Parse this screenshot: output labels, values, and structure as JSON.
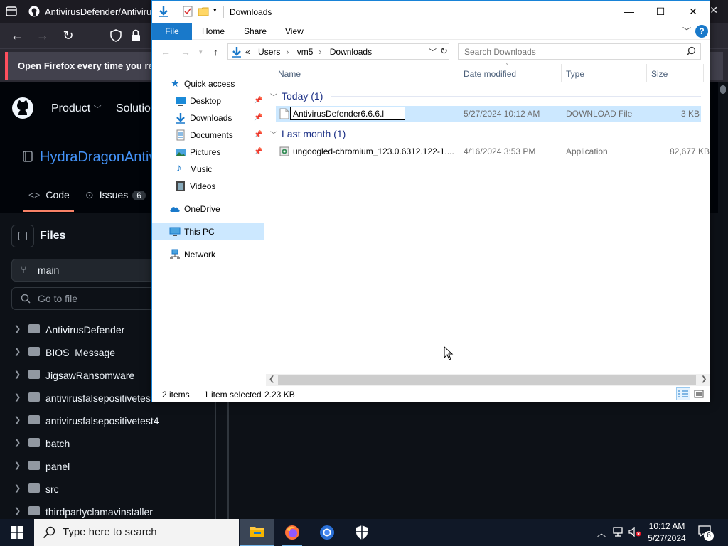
{
  "browser": {
    "tab_title": "AntivirusDefender/Antivirus",
    "notification": "Open Firefox every time you resta",
    "tab_close": "✕"
  },
  "github": {
    "menu": [
      "Product",
      "Solutio"
    ],
    "repo_name": "HydraDragonAntiv",
    "tabs": {
      "code": "Code",
      "issues": "Issues",
      "issues_count": "6"
    },
    "files_title": "Files",
    "branch": "main",
    "go_to_file": "Go to file",
    "tree": [
      "AntivirusDefender",
      "BIOS_Message",
      "JigsawRansomware",
      "antivirusfalsepositivetest",
      "antivirusfalsepositivetest4",
      "batch",
      "panel",
      "src",
      "thirdpartyclamavinstaller"
    ]
  },
  "explorer": {
    "title": "Downloads",
    "window_buttons": {
      "minimize": "—",
      "maximize": "☐",
      "close": "✕"
    },
    "ribbon": {
      "file": "File",
      "home": "Home",
      "share": "Share",
      "view": "View",
      "help": "?"
    },
    "address": {
      "prefix": "«",
      "parts": [
        "Users",
        "vm5",
        "Downloads"
      ]
    },
    "search_placeholder": "Search Downloads",
    "nav": {
      "quick_access": "Quick access",
      "desktop": "Desktop",
      "downloads": "Downloads",
      "documents": "Documents",
      "pictures": "Pictures",
      "music": "Music",
      "videos": "Videos",
      "onedrive": "OneDrive",
      "this_pc": "This PC",
      "network": "Network"
    },
    "columns": {
      "name": "Name",
      "date": "Date modified",
      "type": "Type",
      "size": "Size"
    },
    "groups": {
      "today": "Today (1)",
      "last_month": "Last month (1)"
    },
    "files": [
      {
        "name": "AntivirusDefender6.6.6.l",
        "date": "5/27/2024 10:12 AM",
        "type": "DOWNLOAD File",
        "size": "3 KB",
        "renaming": true
      },
      {
        "name": "ungoogled-chromium_123.0.6312.122-1....",
        "date": "4/16/2024 3:53 PM",
        "type": "Application",
        "size": "82,677 KB"
      }
    ],
    "status": {
      "items": "2 items",
      "selected": "1 item selected",
      "size": "2.23 KB"
    }
  },
  "taskbar": {
    "search_text": "Type here to search",
    "time": "10:12 AM",
    "date": "5/27/2024",
    "notification_count": "6"
  },
  "colors": {
    "accent": "#1979ca",
    "selection": "#cce8ff",
    "github_link": "#4493f8",
    "taskbar": "#101827"
  }
}
